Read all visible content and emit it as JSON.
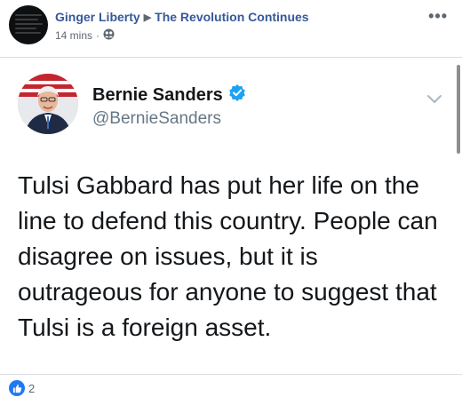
{
  "post": {
    "author": "Ginger Liberty",
    "group": "The Revolution Continues",
    "time": "14 mins",
    "dot": "·",
    "audience_icon": "group-icon",
    "more_icon": "more-dots-icon",
    "more_text": "•••"
  },
  "tweet": {
    "name": "Bernie Sanders",
    "handle": "@BernieSanders",
    "verified_icon": "verified-check-icon",
    "caret_icon": "chevron-down-icon",
    "text": "Tulsi Gabbard has put her life on the line to defend this country. People can disagree on issues, but it is outrageous for anyone to suggest that Tulsi is a foreign asset."
  },
  "reactions": {
    "icon": "like-thumb-icon",
    "count": "2"
  },
  "colors": {
    "fb_link": "#365899",
    "tw_verified": "#1da1f2",
    "like_blue": "#2078f4"
  }
}
